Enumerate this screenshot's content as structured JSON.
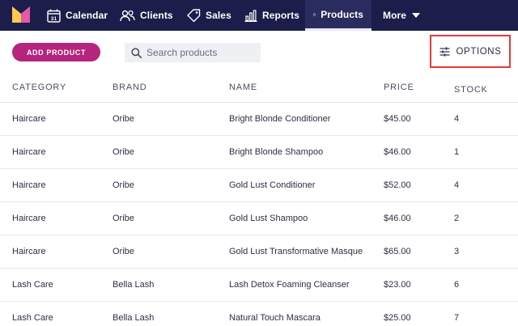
{
  "nav": {
    "items": [
      {
        "label": "Calendar",
        "icon": "calendar-icon",
        "date_badge": "31"
      },
      {
        "label": "Clients",
        "icon": "clients-icon"
      },
      {
        "label": "Sales",
        "icon": "tag-icon"
      },
      {
        "label": "Reports",
        "icon": "bar-chart-icon"
      },
      {
        "label": "Products",
        "icon": "shopping-bag-icon",
        "active": true
      },
      {
        "label": "More",
        "icon": "caret-down-icon"
      }
    ]
  },
  "toolbar": {
    "add_label": "ADD PRODUCT",
    "search_placeholder": "Search products",
    "options_label": "OPTIONS"
  },
  "colors": {
    "nav_bg": "#1c1d4a",
    "accent": "#b5247d",
    "highlight": "#e53935"
  },
  "table": {
    "headers": {
      "category": "CATEGORY",
      "brand": "BRAND",
      "name": "NAME",
      "price": "PRICE",
      "stock": "STOCK"
    },
    "rows": [
      {
        "category": "Haircare",
        "brand": "Oribe",
        "name": "Bright Blonde Conditioner",
        "price": "$45.00",
        "stock": "4"
      },
      {
        "category": "Haircare",
        "brand": "Oribe",
        "name": "Bright Blonde Shampoo",
        "price": "$46.00",
        "stock": "1"
      },
      {
        "category": "Haircare",
        "brand": "Oribe",
        "name": "Gold Lust Conditioner",
        "price": "$52.00",
        "stock": "4"
      },
      {
        "category": "Haircare",
        "brand": "Oribe",
        "name": "Gold Lust Shampoo",
        "price": "$46.00",
        "stock": "2"
      },
      {
        "category": "Haircare",
        "brand": "Oribe",
        "name": "Gold Lust Transformative Masque",
        "price": "$65.00",
        "stock": "3"
      },
      {
        "category": "Lash Care",
        "brand": "Bella Lash",
        "name": "Lash Detox Foaming Cleanser",
        "price": "$23.00",
        "stock": "6"
      },
      {
        "category": "Lash Care",
        "brand": "Bella Lash",
        "name": "Natural Touch Mascara",
        "price": "$25.00",
        "stock": "7"
      }
    ]
  }
}
